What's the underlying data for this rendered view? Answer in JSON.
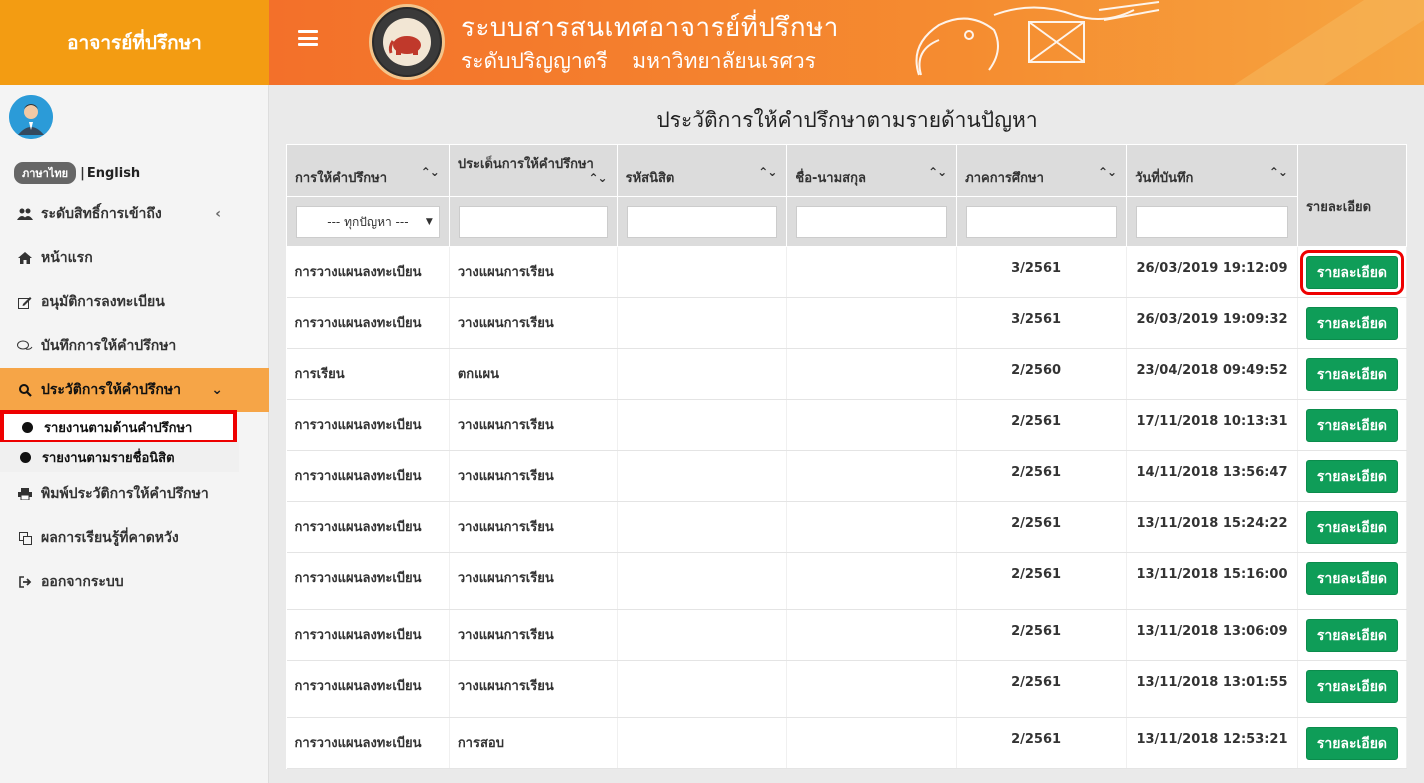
{
  "brand": {
    "title": "อาจารย์ที่ปรึกษา"
  },
  "header": {
    "title": "ระบบสารสนเทศอาจารย์ที่ปรึกษา",
    "subtitle": "ระดับปริญญาตรี มหาวิทยาลัยนเรศวร"
  },
  "lang": {
    "active": "ภาษาไทย",
    "separator": "|",
    "other": "English"
  },
  "sidebar": {
    "items": [
      {
        "label": "ระดับสิทธิ์การเข้าถึง",
        "icon": "users-icon"
      },
      {
        "label": "หน้าแรก",
        "icon": "home-icon"
      },
      {
        "label": "อนุมัติการลงทะเบียน",
        "icon": "edit-icon"
      },
      {
        "label": "บันทึกการให้คำปรึกษา",
        "icon": "comments-icon"
      },
      {
        "label": "ประวัติการให้คำปรึกษา",
        "icon": "search-icon"
      },
      {
        "label": "พิมพ์ประวัติการให้คำปรึกษา",
        "icon": "print-icon"
      },
      {
        "label": "ผลการเรียนรู้ที่คาดหวัง",
        "icon": "copy-icon"
      },
      {
        "label": "ออกจากระบบ",
        "icon": "sign-out-icon"
      }
    ],
    "sub_items": [
      {
        "label": "รายงานตามด้านคำปรึกษา"
      },
      {
        "label": "รายงานตามรายชื่อนิสิต"
      }
    ],
    "chevron_collapsed": "‹",
    "chevron_expanded": "⌄"
  },
  "page": {
    "title": "ประวัติการให้คำปรึกษาตามรายด้านปัญหา"
  },
  "table": {
    "headers": [
      "การให้คำปรึกษา",
      "ประเด็นการให้คำปรึกษา",
      "รหัสนิสิต",
      "ชื่อ-นามสกุล",
      "ภาคการศึกษา",
      "วันที่บันทึก",
      "รายละเอียด"
    ],
    "sort_glyph": "⌃⌄",
    "filter_select": "--- ทุกปัญหา ---",
    "detail_button": "รายละเอียด",
    "rows": [
      [
        "การวางแผนลงทะเบียน",
        "วางแผนการเรียน",
        "",
        "",
        "3/2561",
        "26/03/2019 19:12:09"
      ],
      [
        "การวางแผนลงทะเบียน",
        "วางแผนการเรียน",
        "",
        "",
        "3/2561",
        "26/03/2019 19:09:32"
      ],
      [
        "การเรียน",
        "ตกแผน",
        "",
        "",
        "2/2560",
        "23/04/2018 09:49:52"
      ],
      [
        "การวางแผนลงทะเบียน",
        "วางแผนการเรียน",
        "",
        "",
        "2/2561",
        "17/11/2018 10:13:31"
      ],
      [
        "การวางแผนลงทะเบียน",
        "วางแผนการเรียน",
        "",
        "",
        "2/2561",
        "14/11/2018 13:56:47"
      ],
      [
        "การวางแผนลงทะเบียน",
        "วางแผนการเรียน",
        "",
        "",
        "2/2561",
        "13/11/2018 15:24:22"
      ],
      [
        "การวางแผนลงทะเบียน",
        "วางแผนการเรียน",
        "",
        "",
        "2/2561",
        "13/11/2018 15:16:00"
      ],
      [
        "การวางแผนลงทะเบียน",
        "วางแผนการเรียน",
        "",
        "",
        "2/2561",
        "13/11/2018 13:06:09"
      ],
      [
        "การวางแผนลงทะเบียน",
        "วางแผนการเรียน",
        "",
        "",
        "2/2561",
        "13/11/2018 13:01:55"
      ],
      [
        "การวางแผนลงทะเบียน",
        "การสอบ",
        "",
        "",
        "2/2561",
        "13/11/2018 12:53:21"
      ]
    ]
  },
  "colors": {
    "brand": "#f39c12",
    "active_menu": "#f6a547",
    "button": "#0f9d58",
    "highlight": "#ee0000"
  }
}
